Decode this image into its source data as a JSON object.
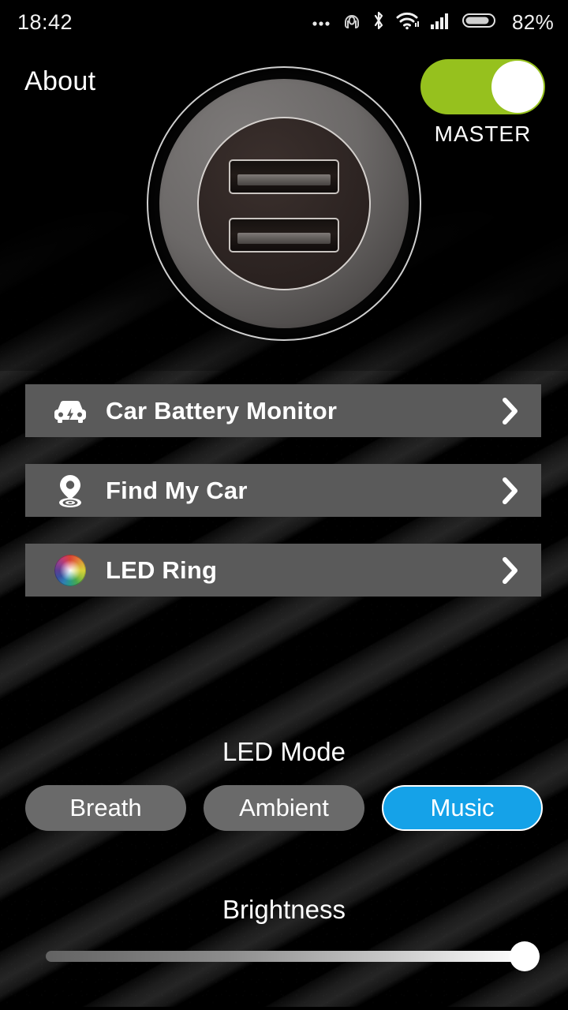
{
  "statusbar": {
    "time": "18:42",
    "battery_percent": "82%",
    "icons": [
      {
        "name": "more-dots-icon"
      },
      {
        "name": "headset-icon"
      },
      {
        "name": "bluetooth-icon"
      },
      {
        "name": "wifi-icon"
      },
      {
        "name": "cell-signal-icon"
      },
      {
        "name": "battery-icon"
      }
    ]
  },
  "header": {
    "title": "About",
    "master_toggle": {
      "label": "MASTER",
      "state": "on",
      "track_color": "#96c11e",
      "knob_color": "#ffffff"
    }
  },
  "hero": {
    "name": "usb-car-charger-image",
    "ports": 2
  },
  "menu": {
    "items": [
      {
        "label": "Car Battery Monitor",
        "icon": "car-battery-icon",
        "chevron": "chevron-right-icon"
      },
      {
        "label": "Find My Car",
        "icon": "location-pin-icon",
        "chevron": "chevron-right-icon"
      },
      {
        "label": "LED Ring",
        "icon": "color-wheel-icon",
        "chevron": "chevron-right-icon"
      }
    ],
    "row_color": "#5a5a5a"
  },
  "led_mode": {
    "title": "LED Mode",
    "options": [
      {
        "label": "Breath",
        "selected": false
      },
      {
        "label": "Ambient",
        "selected": false
      },
      {
        "label": "Music",
        "selected": true
      }
    ],
    "selected_color": "#15a2e8",
    "unselected_color": "#6a6a6a"
  },
  "brightness": {
    "title": "Brightness",
    "value": 100,
    "min": 0,
    "max": 100
  }
}
